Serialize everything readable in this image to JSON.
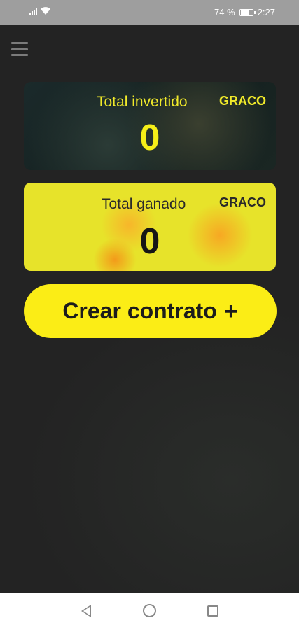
{
  "status_bar": {
    "battery": "74 %",
    "time": "2:27"
  },
  "cards": {
    "invested": {
      "title": "Total invertido",
      "unit": "GRACO",
      "value": "0"
    },
    "earned": {
      "title": "Total ganado",
      "unit": "GRACO",
      "value": "0"
    }
  },
  "actions": {
    "create_contract_label": "Crear contrato",
    "create_contract_icon": "+"
  },
  "icons": {
    "menu": "hamburger-menu-icon",
    "back": "back-triangle-icon",
    "home": "home-circle-icon",
    "recent": "recent-square-icon"
  },
  "colors": {
    "accent_yellow": "#fbed16",
    "background": "#222222"
  }
}
